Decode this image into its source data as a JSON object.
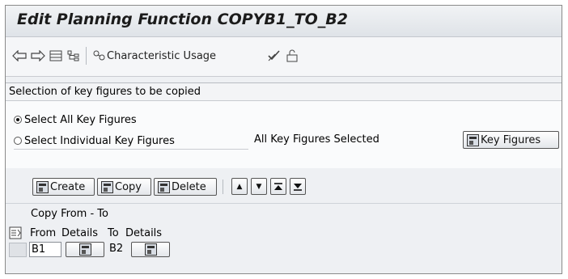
{
  "title": "Edit Planning Function COPYB1_TO_B2",
  "toolbar": {
    "back_icon": "back-arrow-icon",
    "forward_icon": "forward-arrow-icon",
    "characteristic_usage_label": "Characteristic Usage"
  },
  "section": {
    "title": "Selection of key figures to be copied",
    "option_all_label": "Select All Key Figures",
    "option_individual_label": "Select Individual Key Figures",
    "status_text": "All Key Figures Selected",
    "key_figures_button": "Key Figures",
    "selected_option": "all"
  },
  "table_toolbar": {
    "create_label": "Create",
    "copy_label": "Copy",
    "delete_label": "Delete"
  },
  "copy_table": {
    "caption": "Copy From - To",
    "columns": [
      "From",
      "Details",
      "To",
      "Details"
    ],
    "rows": [
      {
        "from": "B1",
        "to": "B2"
      }
    ]
  }
}
